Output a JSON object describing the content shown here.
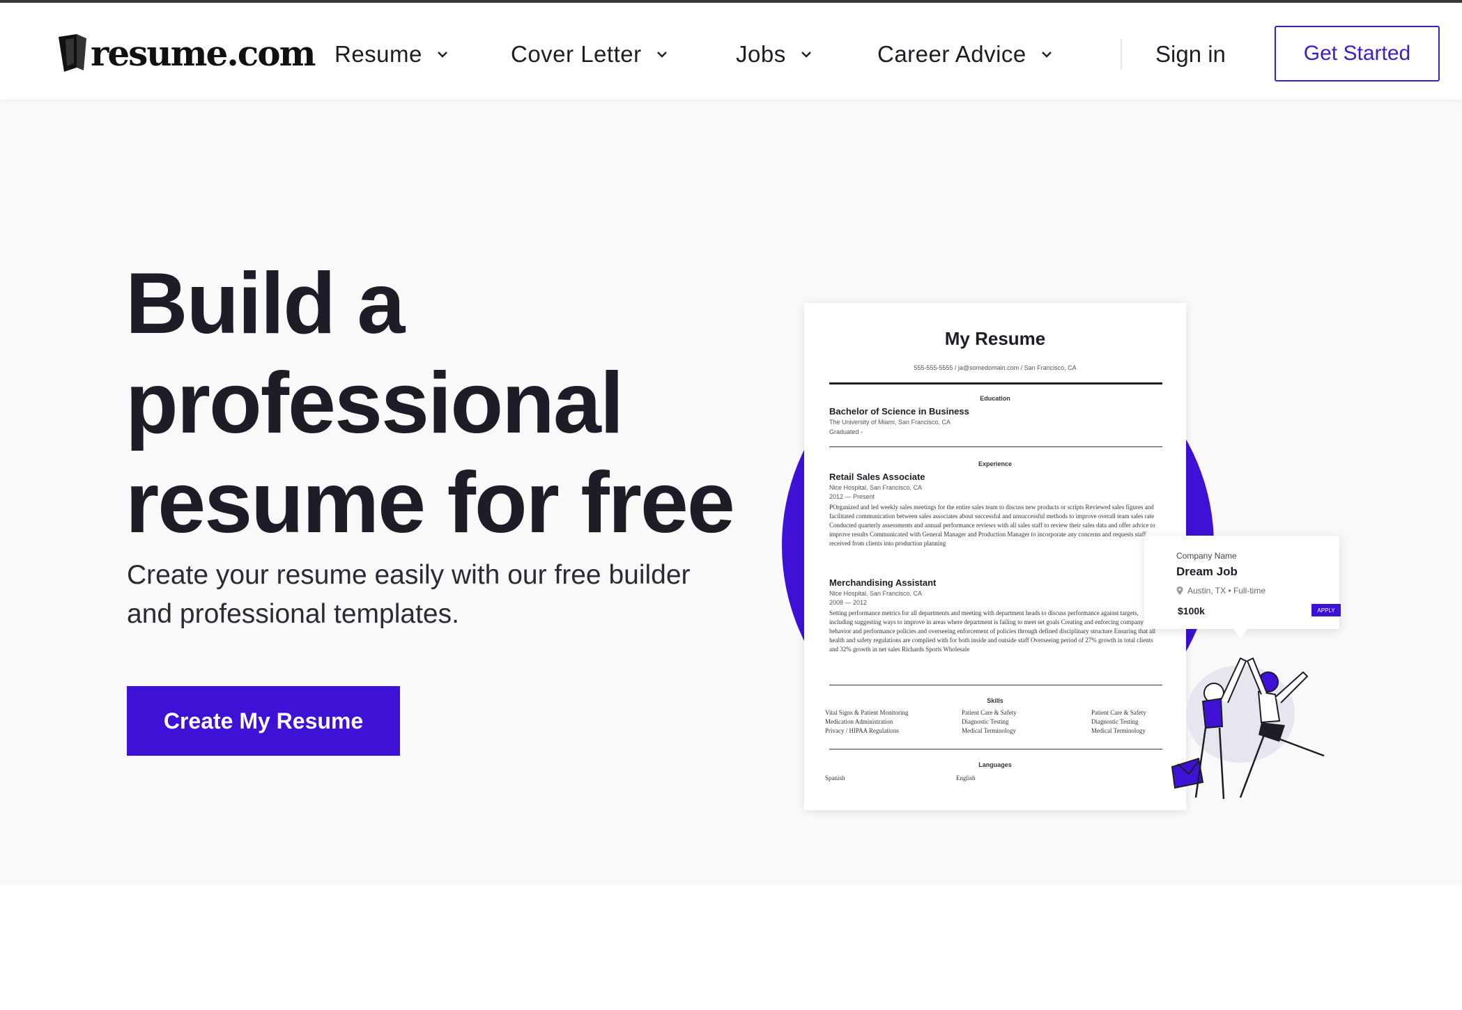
{
  "header": {
    "logo_text": "resume.com",
    "nav": [
      {
        "label": "Resume"
      },
      {
        "label": "Cover Letter"
      },
      {
        "label": "Jobs"
      },
      {
        "label": "Career Advice"
      }
    ],
    "sign_in": "Sign in",
    "get_started": "Get Started"
  },
  "hero": {
    "title": "Build a professional resume for free",
    "subtitle": "Create your resume easily with our free builder and professional templates.",
    "cta": "Create My Resume"
  },
  "resume_preview": {
    "title": "My Resume",
    "contact": "555-555-5555 / ja@somedomain.com / San Francisco, CA",
    "education_head": "Education",
    "degree": "Bachelor of Science in Business",
    "school": "The University of Miami, San Francisco, CA",
    "graduated": "Graduated -",
    "experience_head": "Experience",
    "job1_title": "Retail Sales Associate",
    "job1_place": "Nice Hospital, San Francisco, CA",
    "job1_dates": "2012 — Present",
    "job1_body": "POrganized and led weekly sales meetings for the entire sales team to discuss new products or scripts Reviewed sales figures and facilitated communication between sales associates about successful and unsuccessful methods to improve overall team sales rate Conducted quarterly assessments and annual performance reviews with all sales staff to review their sales data and offer advice to improve results Communicated with General Manager and Production Manager to incorporate any concerns and requests staff received from clients into production planning",
    "job2_title": "Merchandising Assistant",
    "job2_place": "Nice Hospital, San Francisco, CA",
    "job2_dates": "2008 — 2012",
    "job2_body": "Setting performance metrics for all departments and meeting with department heads to discuss performance against targets, including suggesting ways to improve in areas where department is failing to meet set goals Creating and enforcing company behavior and performance policies and overseeing enforcement of policies through defined disciplinary structure Ensuring that all health and safety regulations are complied with for both inside and outside staff Overseeing period of 27% growth in total clients and 32% growth in net sales Richards Sports Wholesale",
    "skills_head": "Skills",
    "skills_col1": [
      "Vital Signs & Patient Monitoring",
      "Medication Administration",
      "Privacy / HIPAA Regulations"
    ],
    "skills_col2": [
      "Patient Care & Safety",
      "Diagnostic Testing",
      "Medical Terminology"
    ],
    "skills_col3": [
      "Patient Care & Safety",
      "Diagnostic Testing",
      "Medical Terminology"
    ],
    "languages_head": "Languages",
    "lang1": "Spanish",
    "lang2": "English"
  },
  "job_card": {
    "company": "Company Name",
    "title": "Dream Job",
    "location": "Austin, TX  •  Full-time",
    "salary": "$100k",
    "apply": "APPLY"
  },
  "colors": {
    "accent": "#3f10d6",
    "text": "#1d1d27",
    "hero_bg": "#f9f9fa"
  },
  "icons": [
    "logo-mark-icon",
    "chevron-down-icon",
    "location-pin-icon"
  ]
}
